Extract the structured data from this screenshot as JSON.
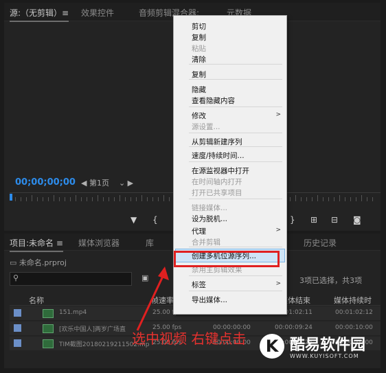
{
  "source_panel": {
    "tabs": [
      "源:（无剪辑）≡",
      "效果控件",
      "音频剪辑混合器:",
      "元数据"
    ],
    "timecode": "00;00;00;00",
    "page": "第1页"
  },
  "project_panel": {
    "tabs": [
      "项目:未命名 ≡",
      "媒体浏览器",
      "库",
      "历史记录"
    ],
    "folder": "未命名.prproj",
    "selection_info": "3项已选择，共3项",
    "columns": [
      "名称",
      "帧速率",
      "媒体结束",
      "媒体持续时"
    ],
    "rows": [
      {
        "name": "151.mp4",
        "fps": "25.00 fps",
        "start": "",
        "end": "00:01:02:11",
        "duration": "00:01:02:12"
      },
      {
        "name": "[欢乐中国人]两岁广场直",
        "fps": "25.00 fps",
        "start": "00:00:00:00",
        "end": "00:00:09:24",
        "duration": "00:00:10:00"
      },
      {
        "name": "TIM截图20180219211502.mp",
        "fps": "25.00 fps",
        "start": "00:00:00:00",
        "end": "00:00:09:24",
        "duration": "00:00:10:00"
      }
    ]
  },
  "context_menu": {
    "items": [
      {
        "label": "剪切",
        "disabled": false
      },
      {
        "label": "复制",
        "disabled": false
      },
      {
        "label": "粘贴",
        "disabled": true
      },
      {
        "label": "清除",
        "disabled": false
      },
      {
        "label": "复制",
        "disabled": false
      },
      {
        "label": "隐藏",
        "disabled": false
      },
      {
        "label": "查看隐藏内容",
        "disabled": false
      },
      {
        "label": "修改",
        "disabled": false,
        "submenu": true
      },
      {
        "label": "源设置...",
        "disabled": true
      },
      {
        "label": "从剪辑新建序列",
        "disabled": false
      },
      {
        "label": "速度/持续时间...",
        "disabled": false
      },
      {
        "label": "在源监视器中打开",
        "disabled": false
      },
      {
        "label": "在时间轴内打开",
        "disabled": true
      },
      {
        "label": "打开已共享项目",
        "disabled": true
      },
      {
        "label": "链接媒体...",
        "disabled": true
      },
      {
        "label": "设为脱机...",
        "disabled": false
      },
      {
        "label": "代理",
        "disabled": false,
        "submenu": true
      },
      {
        "label": "合并剪辑",
        "disabled": true
      },
      {
        "label": "创建多机位源序列...",
        "disabled": false,
        "highlighted": true
      },
      {
        "label": "禁用主剪辑效果",
        "disabled": true
      },
      {
        "label": "标签",
        "disabled": false,
        "submenu": true
      },
      {
        "label": "导出媒体...",
        "disabled": false
      }
    ]
  },
  "annotation": "选中视频 右键点击",
  "watermark": {
    "name": "酷易软件园",
    "url": "WWW.KUYISOFT.COM",
    "logo_letter": "K"
  },
  "colors": {
    "timecode": "#2d8ceb",
    "highlight_border": "#e02020",
    "annotation": "#e6322f"
  }
}
